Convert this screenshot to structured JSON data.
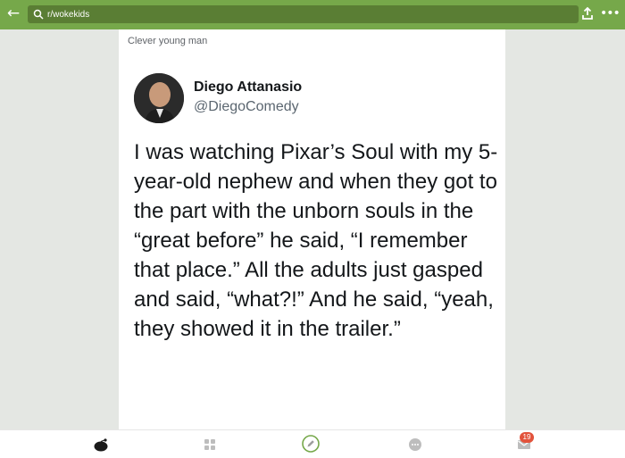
{
  "search": {
    "value": "r/wokekids"
  },
  "post": {
    "title": "Clever young man",
    "author_name": "Diego Attanasio",
    "author_handle": "@DiegoComedy",
    "text": "I was watching Pixar’s Soul with my 5-year-old nephew and when they got to the part with the unborn souls in the “great before” he said, “I remember that place.” All the adults just gasped and said, “what?!” And he said, “yeah, they showed it in the trailer.”"
  },
  "nav": {
    "items": [
      "home-icon",
      "browse-icon",
      "compose-icon",
      "chat-icon",
      "inbox-icon"
    ],
    "inbox_badge": "19"
  },
  "colors": {
    "topbar": "#76a84a",
    "accent": "#76a84a",
    "badge": "#e2533c"
  }
}
